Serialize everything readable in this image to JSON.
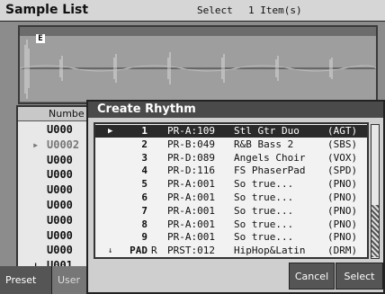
{
  "header": {
    "title": "Sample List",
    "select_label": "Select",
    "select_count": "1 Item(s)"
  },
  "waveform": {
    "marker": "E"
  },
  "sample_list": {
    "column_header": "Numbe",
    "rows": [
      {
        "code": "U000",
        "selected": false
      },
      {
        "code": "U0002",
        "selected": true
      },
      {
        "code": "U000",
        "selected": false
      },
      {
        "code": "U000",
        "selected": false
      },
      {
        "code": "U000",
        "selected": false
      },
      {
        "code": "U000",
        "selected": false
      },
      {
        "code": "U000",
        "selected": false
      },
      {
        "code": "U000",
        "selected": false
      },
      {
        "code": "U000",
        "selected": false
      },
      {
        "code": "U001",
        "selected": false
      }
    ]
  },
  "tabs": {
    "preset": "Preset",
    "user": "User"
  },
  "dialog": {
    "title": "Create Rhythm",
    "rows": [
      {
        "num": "1",
        "r": "",
        "prog": "PR-A:109",
        "name": "Stl Gtr Duo",
        "cat": "(AGT)",
        "selected": true
      },
      {
        "num": "2",
        "r": "",
        "prog": "PR-B:049",
        "name": "R&B Bass 2",
        "cat": "(SBS)",
        "selected": false
      },
      {
        "num": "3",
        "r": "",
        "prog": "PR-D:089",
        "name": "Angels Choir",
        "cat": "(VOX)",
        "selected": false
      },
      {
        "num": "4",
        "r": "",
        "prog": "PR-D:116",
        "name": "FS PhaserPad",
        "cat": "(SPD)",
        "selected": false
      },
      {
        "num": "5",
        "r": "",
        "prog": "PR-A:001",
        "name": "So true...",
        "cat": "(PNO)",
        "selected": false
      },
      {
        "num": "6",
        "r": "",
        "prog": "PR-A:001",
        "name": "So true...",
        "cat": "(PNO)",
        "selected": false
      },
      {
        "num": "7",
        "r": "",
        "prog": "PR-A:001",
        "name": "So true...",
        "cat": "(PNO)",
        "selected": false
      },
      {
        "num": "8",
        "r": "",
        "prog": "PR-A:001",
        "name": "So true...",
        "cat": "(PNO)",
        "selected": false
      },
      {
        "num": "9",
        "r": "",
        "prog": "PR-A:001",
        "name": "So true...",
        "cat": "(PNO)",
        "selected": false
      },
      {
        "num": "PAD",
        "r": "R",
        "prog": "PRST:012",
        "name": "HipHop&Latin",
        "cat": "(DRM)",
        "selected": false
      }
    ],
    "cancel_label": "Cancel",
    "select_label": "Select"
  }
}
